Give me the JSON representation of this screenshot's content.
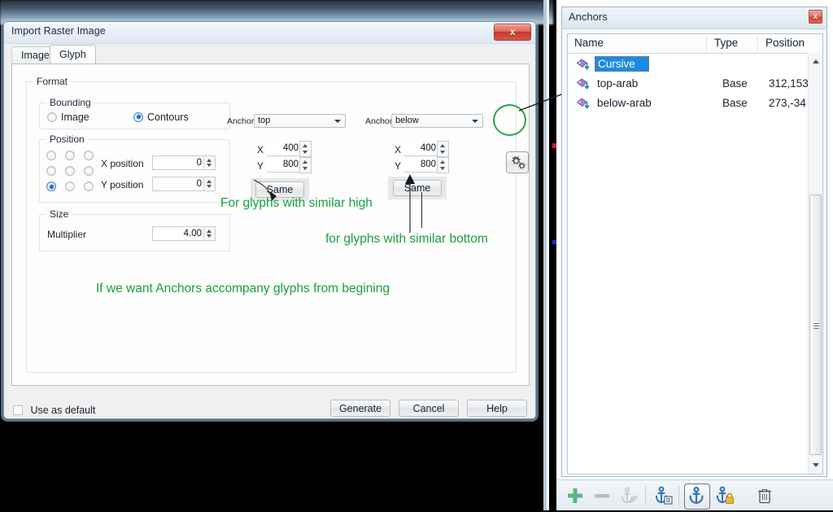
{
  "dialog": {
    "title": "Import Raster Image",
    "close_label": "x",
    "tabs": [
      {
        "label": "Image",
        "active": false
      },
      {
        "label": "Glyph",
        "active": true
      }
    ],
    "format_group": "Format",
    "bounding": {
      "label": "Bounding",
      "options": [
        {
          "label": "Image",
          "selected": false
        },
        {
          "label": "Contours",
          "selected": true
        }
      ]
    },
    "position": {
      "label": "Position",
      "grid_selected": "bottom-left",
      "x_label": "X position",
      "x_value": "0",
      "y_label": "Y position",
      "y_value": "0"
    },
    "size": {
      "label": "Size",
      "multiplier_label": "Multiplier",
      "multiplier_value": "4.00"
    },
    "anchor_top": {
      "anchor_label": "Anchor:",
      "anchor_value": "top",
      "x_label": "X",
      "x_value": "400",
      "y_label": "Y",
      "y_value": "800",
      "same_label": "Same"
    },
    "anchor_below": {
      "anchor_label": "Anchor:",
      "anchor_value": "below",
      "x_label": "X",
      "x_value": "400",
      "y_label": "Y",
      "y_value": "800",
      "same_label": "Same"
    },
    "gear_button": "gear-icon",
    "footer": {
      "use_as_default_label": "Use as default",
      "use_as_default_checked": false,
      "generate_label": "Generate",
      "cancel_label": "Cancel",
      "help_label": "Help"
    }
  },
  "annotations": {
    "green_color": "#1a9e3f",
    "note_top": "For glyphs with similar high",
    "note_bottom": "for glyphs with similar bottom",
    "note_main": "If we want Anchors accompany glyphs from begining"
  },
  "anchors_panel": {
    "title": "Anchors",
    "close_label": "x",
    "columns": [
      "Name",
      "Type",
      "Position"
    ],
    "rows": [
      {
        "name": "Cursive",
        "type": "",
        "position": "",
        "editing": true
      },
      {
        "name": "top-arab",
        "type": "Base",
        "position": "312,153",
        "editing": false
      },
      {
        "name": "below-arab",
        "type": "Base",
        "position": "273,-34",
        "editing": false
      }
    ],
    "toolbar": [
      {
        "icon": "plus-icon",
        "enabled": true,
        "selected": false
      },
      {
        "icon": "minus-icon",
        "enabled": false,
        "selected": false
      },
      {
        "icon": "anchor-edit-icon",
        "enabled": false,
        "selected": false
      },
      {
        "icon": "anchor-list-icon",
        "enabled": true,
        "selected": false
      },
      {
        "icon": "anchor-icon",
        "enabled": true,
        "selected": true
      },
      {
        "icon": "anchor-lock-icon",
        "enabled": true,
        "selected": false
      },
      {
        "icon": "trash-icon",
        "enabled": true,
        "selected": false
      }
    ]
  }
}
